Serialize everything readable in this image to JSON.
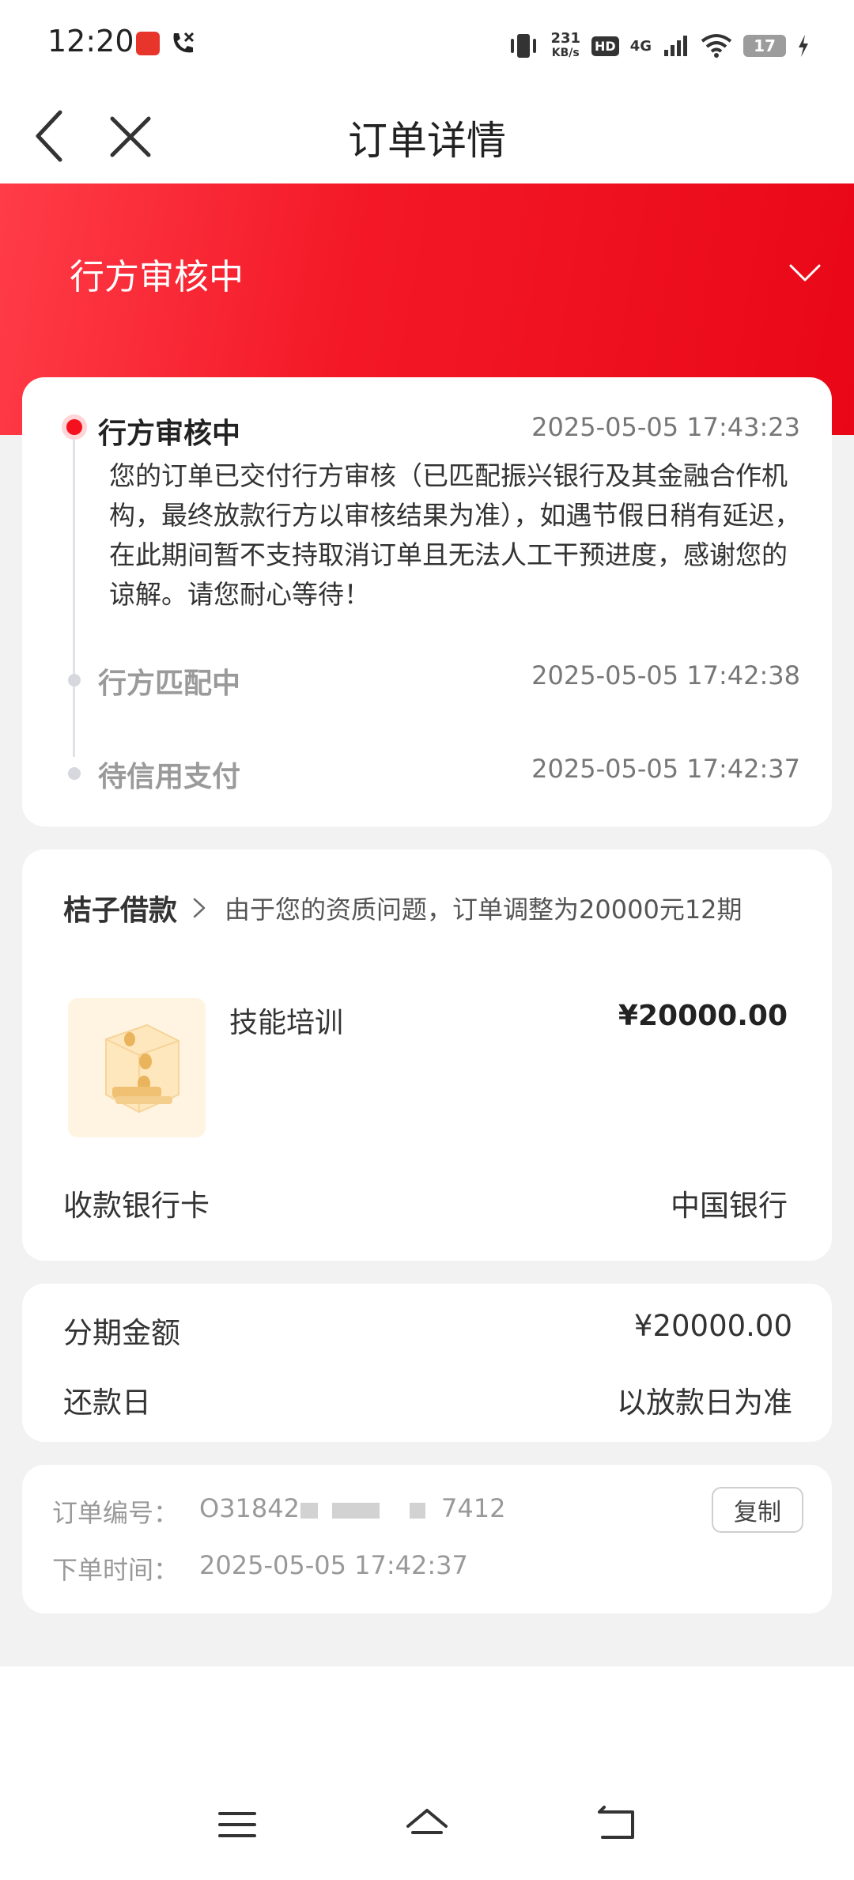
{
  "status_bar": {
    "time": "12:20",
    "speed_value": "231",
    "speed_unit": "KB/s",
    "hd_label": "HD",
    "network_label": "4G",
    "battery_level": "17",
    "icons": [
      "app-notification-icon",
      "phone-call-icon",
      "vibrate-icon",
      "signal-icon",
      "wifi-icon",
      "battery-icon",
      "charging-icon"
    ]
  },
  "nav": {
    "title": "订单详情",
    "icons": [
      "back-arrow-icon",
      "close-icon"
    ]
  },
  "status_header": {
    "title": "行方审核中",
    "icon": "chevron-down-icon"
  },
  "timeline": [
    {
      "title": "行方审核中",
      "time": "2025-05-05 17:43:23",
      "description": "您的订单已交付行方审核（已匹配振兴银行及其金融合作机构，最终放款行方以审核结果为准），如遇节假日稍有延迟，在此期间暂不支持取消订单且无法人工干预进度，感谢您的谅解。请您耐心等待！",
      "active": true
    },
    {
      "title": "行方匹配中",
      "time": "2025-05-05 17:42:38",
      "active": false
    },
    {
      "title": "待信用支付",
      "time": "2025-05-05 17:42:37",
      "active": false
    }
  ],
  "product": {
    "brand": "桔子借款",
    "notice": "由于您的资质问题，订单调整为20000元12期",
    "name": "技能培训",
    "price": "¥20000.00",
    "bank_label": "收款银行卡",
    "bank_value": "中国银行",
    "image_icon": "coins-box-icon"
  },
  "amount": {
    "installment_label": "分期金额",
    "installment_value": "¥20000.00",
    "repay_label": "还款日",
    "repay_value": "以放款日为准"
  },
  "order": {
    "number_label": "订单编号：",
    "number_prefix": "O31842",
    "number_suffix": "7412",
    "copy_label": "复制",
    "time_label": "下单时间：",
    "time_value": "2025-05-05 17:42:37"
  },
  "bottom_nav": {
    "icons": [
      "menu-icon",
      "home-icon",
      "return-icon"
    ]
  },
  "colors": {
    "accent_red": "#f41927",
    "header_gradient_start": "#ff3c48",
    "header_gradient_end": "#e90717",
    "page_gray": "#f2f2f2"
  }
}
